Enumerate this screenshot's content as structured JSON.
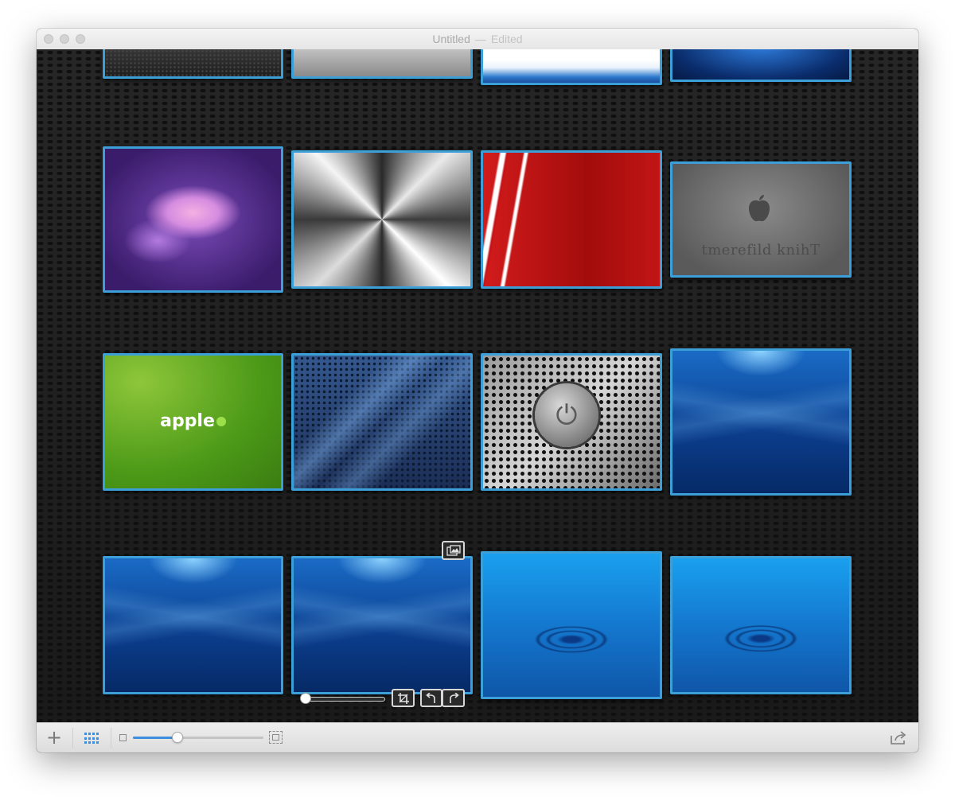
{
  "window": {
    "title": "Untitled",
    "separator": "—",
    "status": "Edited"
  },
  "colors": {
    "accent": "#3d9fd8",
    "canvas": "#1c1c1c",
    "toolbar": "#e5e5e5"
  },
  "images": [
    {
      "row": 1,
      "col": 1,
      "name": "dark-mesh",
      "art": "art-dark"
    },
    {
      "row": 1,
      "col": 2,
      "name": "brushed-metal",
      "art": "art-brushed"
    },
    {
      "row": 1,
      "col": 3,
      "name": "white-blue-wave",
      "art": "art-whitewave"
    },
    {
      "row": 1,
      "col": 4,
      "name": "deep-blue",
      "art": "art-deepblue"
    },
    {
      "row": 2,
      "col": 1,
      "name": "purple-clouds",
      "art": "art-purple"
    },
    {
      "row": 2,
      "col": 2,
      "name": "radial-brushed-steel",
      "art": "art-conic"
    },
    {
      "row": 2,
      "col": 3,
      "name": "red-swirl",
      "art": "art-red"
    },
    {
      "row": 2,
      "col": 4,
      "name": "gray-apple",
      "art": "art-gray",
      "text": "tmerefild knihT"
    },
    {
      "row": 3,
      "col": 1,
      "name": "green-apple",
      "art": "art-green",
      "text": "apple"
    },
    {
      "row": 3,
      "col": 2,
      "name": "leopard",
      "art": "art-leopard"
    },
    {
      "row": 3,
      "col": 3,
      "name": "speaker-grill-power",
      "art": "art-speaker"
    },
    {
      "row": 3,
      "col": 4,
      "name": "underwater-1",
      "art": "art-underwater"
    },
    {
      "row": 4,
      "col": 1,
      "name": "underwater-2",
      "art": "art-underwater"
    },
    {
      "row": 4,
      "col": 2,
      "name": "underwater-3",
      "art": "art-underwater"
    },
    {
      "row": 4,
      "col": 3,
      "name": "water-drop-1",
      "art": "art-ripple"
    },
    {
      "row": 4,
      "col": 4,
      "name": "water-drop-2",
      "art": "art-ripple"
    }
  ],
  "overlay": {
    "icons": [
      "replace-image-icon",
      "crop-icon",
      "rotate-left-icon",
      "rotate-right-icon"
    ],
    "image_zoom": 0.0
  },
  "toolbar": {
    "icons": [
      "add-icon",
      "grid-view-icon",
      "small-image-icon",
      "large-image-icon",
      "share-icon"
    ],
    "zoom_level": 0.34
  }
}
